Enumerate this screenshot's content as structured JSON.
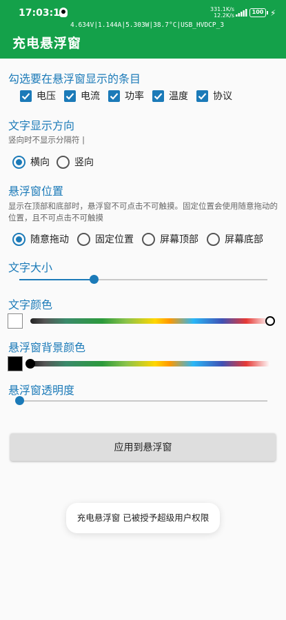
{
  "status_bar": {
    "time": "17:03:19",
    "net_up": "331.1K/s",
    "net_down": "12.2K/s",
    "battery": "100"
  },
  "app_bar": {
    "float_readout": "4.634V|1.144A|5.303W|38.7°C|USB_HVDCP_3",
    "title": "充电悬浮窗"
  },
  "items_section": {
    "title": "勾选要在悬浮窗显示的条目",
    "checkboxes": [
      {
        "label": "电压",
        "checked": true
      },
      {
        "label": "电流",
        "checked": true
      },
      {
        "label": "功率",
        "checked": true
      },
      {
        "label": "温度",
        "checked": true
      },
      {
        "label": "协议",
        "checked": true
      }
    ]
  },
  "direction_section": {
    "title": "文字显示方向",
    "hint": "竖向时不显示分隔符 |",
    "options": [
      {
        "label": "横向",
        "selected": true
      },
      {
        "label": "竖向",
        "selected": false
      }
    ]
  },
  "position_section": {
    "title": "悬浮窗位置",
    "hint": "显示在顶部和底部时，悬浮窗不可点击不可触摸。固定位置会使用随意拖动的位置，且不可点击不可触摸",
    "options": [
      {
        "label": "随意拖动",
        "selected": true
      },
      {
        "label": "固定位置",
        "selected": false
      },
      {
        "label": "屏幕顶部",
        "selected": false
      },
      {
        "label": "屏幕底部",
        "selected": false
      }
    ]
  },
  "text_size_section": {
    "title": "文字大小",
    "value_fraction": 0.3
  },
  "text_color_section": {
    "title": "文字颜色",
    "swatch_color": "#ffffff",
    "picker_fraction": 1.0
  },
  "bg_color_section": {
    "title": "悬浮窗背景颜色",
    "swatch_color": "#000000",
    "picker_fraction": 0.0
  },
  "opacity_section": {
    "title": "悬浮窗透明度",
    "value_fraction": 0.0
  },
  "apply_button": {
    "label": "应用到悬浮窗"
  },
  "toast": {
    "message": "充电悬浮窗 已被授予超级用户权限"
  },
  "colors": {
    "app_bar": "#14a14a",
    "accent": "#1b7ab8"
  }
}
